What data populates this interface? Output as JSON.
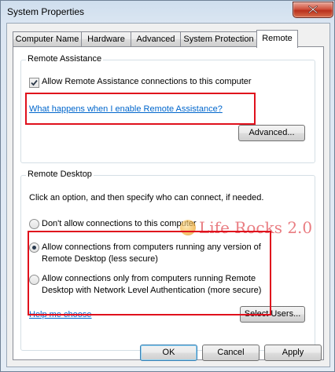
{
  "window": {
    "title": "System Properties"
  },
  "tabs": [
    "Computer Name",
    "Hardware",
    "Advanced",
    "System Protection",
    "Remote"
  ],
  "remote_assistance": {
    "group_label": "Remote Assistance",
    "allow_label": "Allow Remote Assistance connections to this computer",
    "allow_checked": true,
    "help_link": "What happens when I enable Remote Assistance?",
    "advanced_button": "Advanced..."
  },
  "remote_desktop": {
    "group_label": "Remote Desktop",
    "instruction": "Click an option, and then specify who can connect, if needed.",
    "options": [
      {
        "line1": "Don't allow connections to this computer",
        "line2": "",
        "selected": false
      },
      {
        "line1": "Allow connections from computers running any version of",
        "line2": "Remote Desktop (less secure)",
        "selected": true
      },
      {
        "line1": "Allow connections only from computers running Remote",
        "line2": "Desktop with Network Level Authentication (more secure)",
        "selected": false
      }
    ],
    "help_link": "Help me choose",
    "select_users_button": "Select Users..."
  },
  "buttons": {
    "ok": "OK",
    "cancel": "Cancel",
    "apply": "Apply"
  },
  "watermark": "Life Rocks 2.0",
  "colors": {
    "highlight": "#e0101c",
    "link": "#0066cc"
  }
}
